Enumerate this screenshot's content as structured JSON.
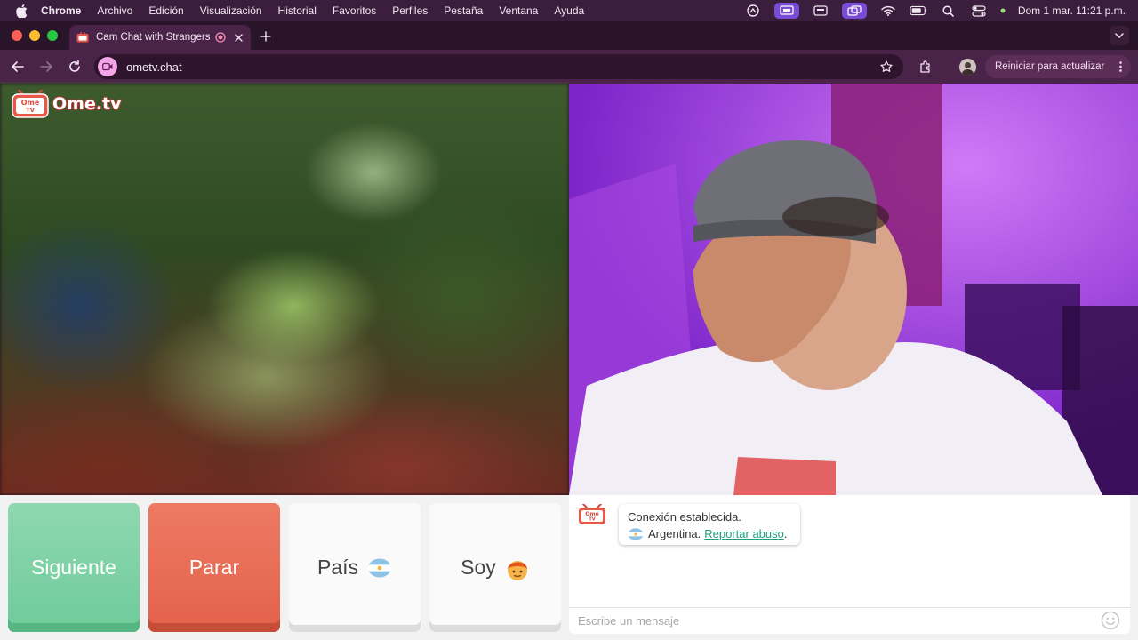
{
  "menubar": {
    "app": "Chrome",
    "items": [
      "Archivo",
      "Edición",
      "Visualización",
      "Historial",
      "Favoritos",
      "Perfiles",
      "Pestaña",
      "Ventana",
      "Ayuda"
    ],
    "clock": "Dom 1 mar.  11:21 p.m."
  },
  "tab": {
    "title": "Cam Chat with Strangers"
  },
  "toolbar": {
    "url": "ometv.chat",
    "update_label": "Reiniciar para actualizar"
  },
  "logo": {
    "tv_label_top": "Ome",
    "tv_label_bottom": "TV",
    "word": "Ome.tv"
  },
  "controls": {
    "next_label": "Siguiente",
    "stop_label": "Parar",
    "country_label": "País",
    "gender_label": "Soy"
  },
  "chat": {
    "status_line": "Conexión establecida.",
    "country": "Argentina.",
    "report_link": "Reportar abuso",
    "report_suffix": ".",
    "input_placeholder": "Escribe un mensaje"
  },
  "colors": {
    "next": "#7ed1a6",
    "stop": "#e86c55",
    "link": "#1e9f7c",
    "chrome_toolbar": "#4a2448"
  },
  "icons": [
    "apple-icon",
    "screen-mirror-icon",
    "wifi-icon",
    "battery-icon",
    "search-icon",
    "control-center-icon",
    "record-icon",
    "close-icon",
    "plus-icon",
    "chevron-down-icon",
    "back-icon",
    "forward-icon",
    "reload-icon",
    "star-icon",
    "extensions-icon",
    "kebab-icon",
    "emoji-icon",
    "argentina-flag-icon"
  ]
}
